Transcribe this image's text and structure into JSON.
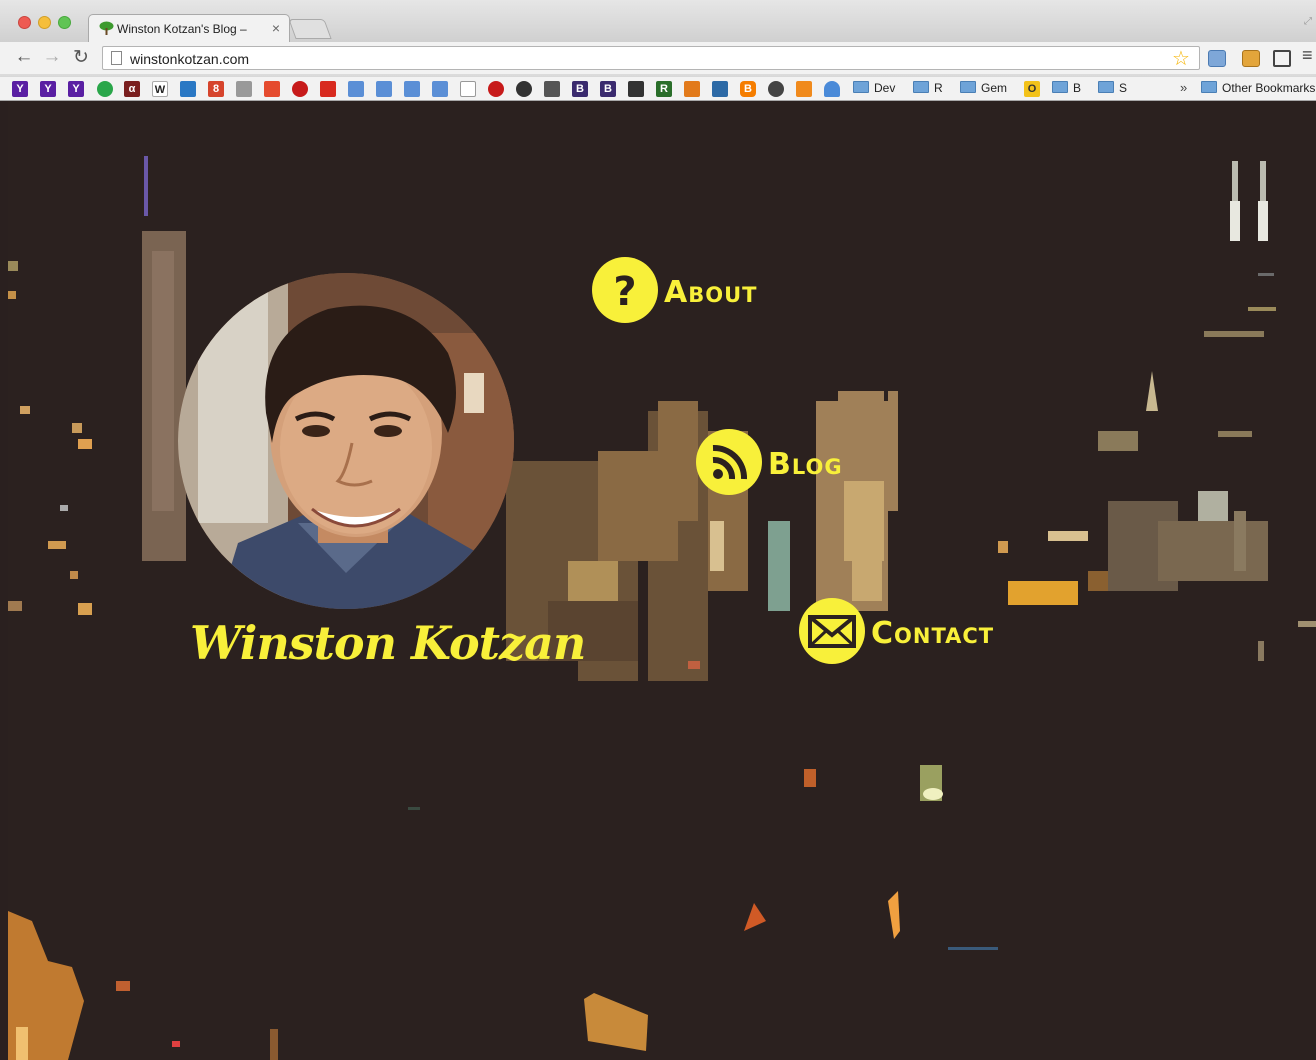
{
  "browser": {
    "tab_title": "Winston Kotzan's Blog –",
    "tab_close": "×",
    "url": "winstonkotzan.com",
    "bookmark_overflow": "»",
    "bookmark_folders": [
      "Dev",
      "R",
      "Gem",
      "B",
      "S"
    ],
    "other_bookmarks": "Other Bookmarks"
  },
  "profile": {
    "name": "Winston Kotzan"
  },
  "nav": {
    "about": "About",
    "blog": "Blog",
    "contact": "Contact"
  },
  "colors": {
    "accent": "#f8f03a",
    "background": "#2b211f"
  }
}
